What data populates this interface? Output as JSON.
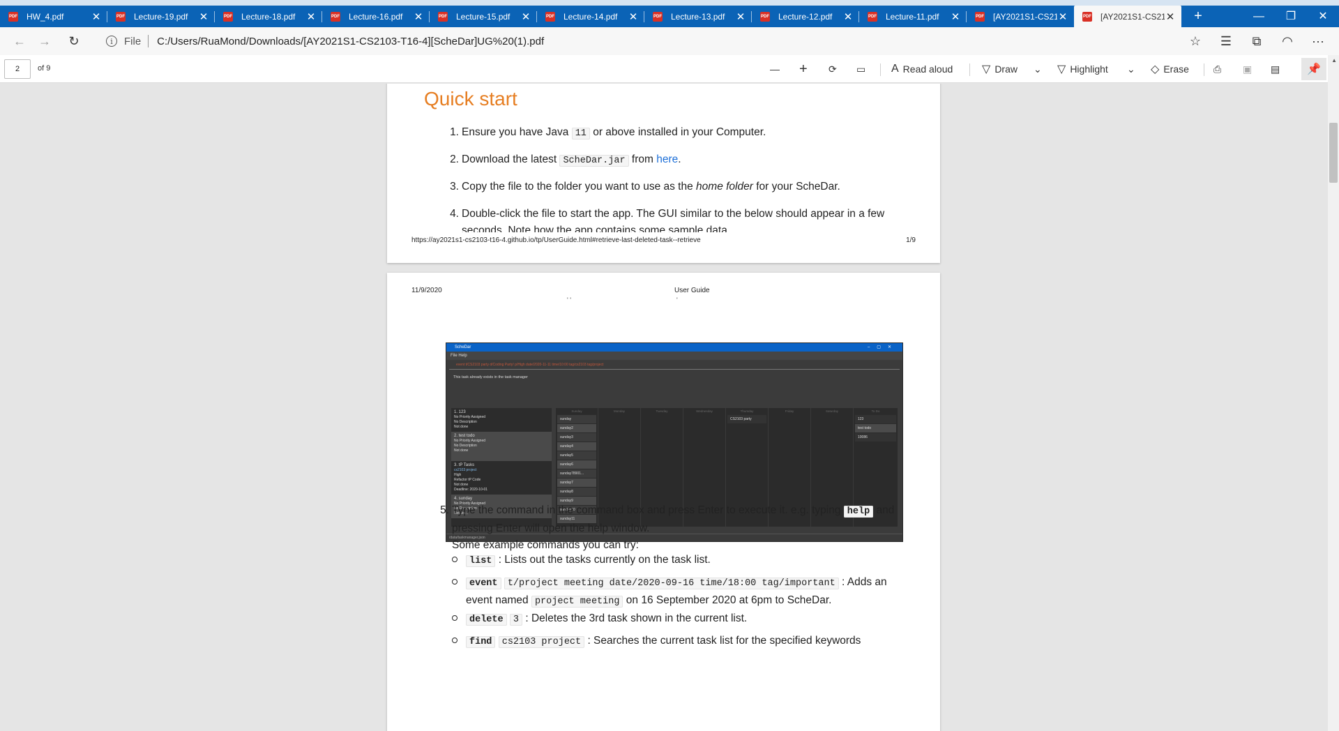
{
  "tabs": [
    {
      "title": "HW_4.pdf",
      "pdf_badge": "PDF"
    },
    {
      "title": "Lecture-19.pdf",
      "pdf_badge": "PDF"
    },
    {
      "title": "Lecture-18.pdf",
      "pdf_badge": "PDF"
    },
    {
      "title": "Lecture-16.pdf",
      "pdf_badge": "PDF"
    },
    {
      "title": "Lecture-15.pdf",
      "pdf_badge": "PDF"
    },
    {
      "title": "Lecture-14.pdf",
      "pdf_badge": "PDF"
    },
    {
      "title": "Lecture-13.pdf",
      "pdf_badge": "PDF"
    },
    {
      "title": "Lecture-12.pdf",
      "pdf_badge": "PDF"
    },
    {
      "title": "Lecture-11.pdf",
      "pdf_badge": "PDF"
    },
    {
      "title": "[AY2021S1-CS21",
      "pdf_badge": "PDF"
    },
    {
      "title": "[AY2021S1-CS21",
      "pdf_badge": "PDF",
      "active": true
    }
  ],
  "address": {
    "file_label": "File",
    "url": "C:/Users/RuaMond/Downloads/[AY2021S1-CS2103-T16-4][ScheDar]UG%20(1).pdf"
  },
  "pdf_toolbar": {
    "page_number": "2",
    "page_count": "of 9",
    "read_aloud": "Read aloud",
    "draw": "Draw",
    "highlight": "Highlight",
    "erase": "Erase"
  },
  "page1": {
    "heading": "Quick start",
    "step1": {
      "num": "1.",
      "pre": "Ensure you have Java ",
      "code": "11",
      "post": " or above installed in your Computer."
    },
    "step2": {
      "num": "2.",
      "pre": "Download the latest ",
      "code": "ScheDar.jar",
      "mid": " from ",
      "link": "here",
      "post": "."
    },
    "step3": {
      "num": "3.",
      "pre": "Copy the file to the folder you want to use as the ",
      "em": "home folder",
      "post": " for your ScheDar."
    },
    "step4": {
      "num": "4.",
      "line1": "Double-click the file to start the app. The GUI similar to the below should appear in a few",
      "line2": "seconds. Note how the app contains some sample data."
    },
    "footer_url": "https://ay2021s1-cs2103-t16-4.github.io/tp/UserGuide.html#retrieve-last-deleted-task--retrieve",
    "footer_page": "1/9"
  },
  "page2": {
    "header_date": "11/9/2020",
    "header_title": "User Guide",
    "screenshot": {
      "title": "ScheDar",
      "menu": "File   Help",
      "command": "event t/CS2103 party d/Coding Party! p/High date/2020-11-11 time/10:00 tag/cs2103 tag/project",
      "result": "This task already exists in the task manager",
      "tasks": [
        {
          "title": "1. 123",
          "l1": "No Priority Assigned",
          "l2": "No Description",
          "l3": "Not done"
        },
        {
          "title": "2. test todo",
          "l1": "No Priority Assigned",
          "l2": "No Description",
          "l3": "Not done"
        },
        {
          "title": "3. tP Tasks",
          "l1": "cs2103  project",
          "l2": "High",
          "l3": "Refactor tP Code",
          "l4": "Not done",
          "l5": "Deadline: 2020-10-01"
        },
        {
          "title": "4. sunday",
          "l1": "No Priority Assigned",
          "l2": "No Description",
          "l3": "Not done"
        }
      ],
      "days": [
        "Sunday",
        "Monday",
        "Tuesday",
        "Wednesday",
        "Thursday",
        "Friday",
        "Saturday",
        "To Do"
      ],
      "sunday_items": [
        "sunday",
        "sunday2",
        "sunday3",
        "sunday4",
        "sunday5",
        "sunday6",
        "sunday78901...",
        "sunday7",
        "sunday8",
        "sunday9",
        "sunday10",
        "sunday11"
      ],
      "thursday_items": [
        "CS2103 party"
      ],
      "todo_items": [
        "123",
        "test todo",
        "10086"
      ],
      "status": "/data/taskmanager.json"
    },
    "step5": {
      "num": "5.",
      "pre": "Type the command in the command box and press Enter to execute it. e.g. typing ",
      "code": "help",
      "post": " and",
      "line2": "pressing Enter will open the help window.",
      "line3": "Some example commands you can try:"
    },
    "bullets": [
      {
        "code": "list",
        "text": " : Lists out the tasks currently on the task list."
      },
      {
        "code": "event",
        "code2": "t/project meeting date/2020-09-16 time/18:00 tag/important",
        "text": " : Adds an",
        "line2_pre": "event named ",
        "line2_code": "project meeting",
        "line2_post": " on 16 September 2020 at 6pm to ScheDar."
      },
      {
        "code": "delete",
        "code2": "3",
        "text": " : Deletes the 3rd task shown in the current list."
      },
      {
        "code": "find",
        "code2": "cs2103 project",
        "text": " : Searches the current task list for the specified keywords"
      }
    ]
  }
}
